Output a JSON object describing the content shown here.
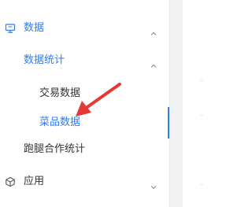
{
  "sidebar": {
    "groups": [
      {
        "label": "数据",
        "icon": "monitor-icon",
        "expanded": true,
        "subgroups": [
          {
            "label": "数据统计",
            "expanded": true,
            "items": [
              {
                "label": "交易数据",
                "active": false
              },
              {
                "label": "菜品数据",
                "active": true
              }
            ]
          },
          {
            "label": "跑腿合作统计"
          }
        ]
      },
      {
        "label": "应用",
        "icon": "cube-icon",
        "expanded": false
      }
    ]
  },
  "annotation": {
    "type": "arrow",
    "color": "#e53935",
    "points_to": "菜品数据"
  },
  "colors": {
    "accent": "#2f7cf6",
    "text": "#333333",
    "annotation": "#e53935"
  }
}
